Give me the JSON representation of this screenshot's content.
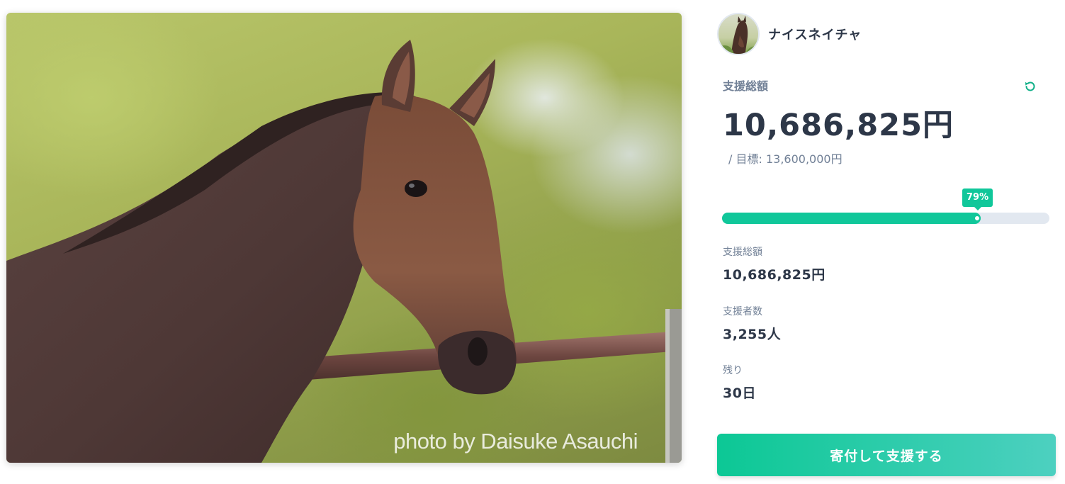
{
  "hero": {
    "photo_alt": "bay horse",
    "credit": "photo by Daisuke Asauchi"
  },
  "owner": {
    "name": "ナイスネイチャ",
    "avatar_icon": "horse-avatar"
  },
  "funding": {
    "total_label": "支援総額",
    "total_amount": "10,686,825円",
    "goal_text": "/ 目標: 13,600,000円",
    "progress_percent": 79,
    "progress_label": "79%"
  },
  "stats": [
    {
      "label": "支援総額",
      "value": "10,686,825円"
    },
    {
      "label": "支援者数",
      "value": "3,255人"
    },
    {
      "label": "残り",
      "value": "30日"
    }
  ],
  "cta": {
    "label": "寄付して支援する"
  },
  "colors": {
    "accent": "#10c79a",
    "track": "#e2e8f0",
    "text_dark": "#2d3748",
    "text_muted": "#718096"
  }
}
